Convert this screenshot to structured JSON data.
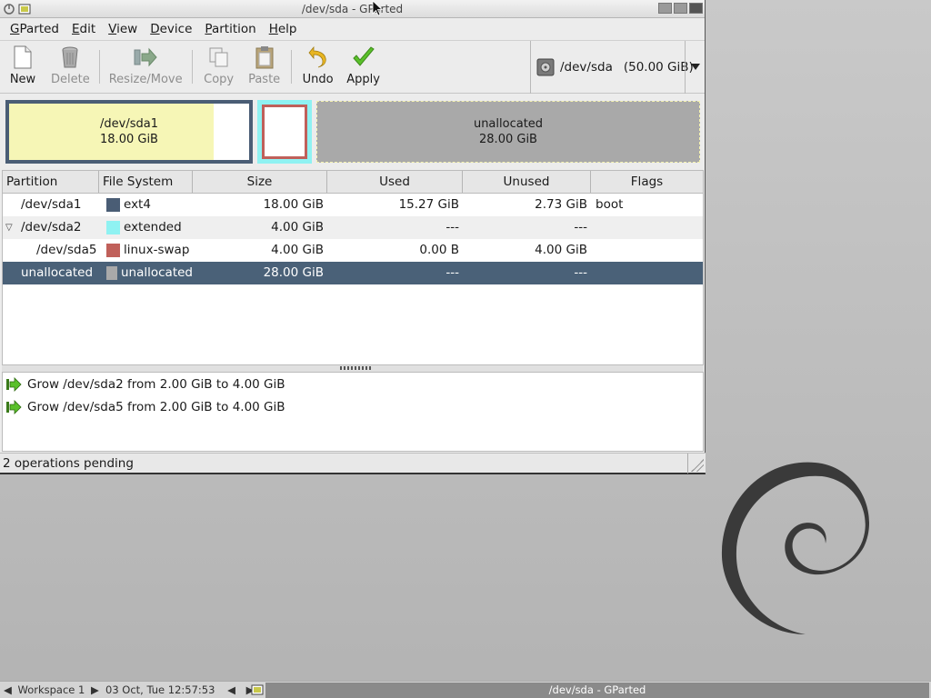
{
  "window": {
    "title": "/dev/sda - GParted"
  },
  "menu": [
    "GParted",
    "Edit",
    "View",
    "Device",
    "Partition",
    "Help"
  ],
  "toolbar": {
    "new": "New",
    "delete": "Delete",
    "resize": "Resize/Move",
    "copy": "Copy",
    "paste": "Paste",
    "undo": "Undo",
    "apply": "Apply"
  },
  "device": {
    "name": "/dev/sda",
    "size": "(50.00 GiB)"
  },
  "diskmap": {
    "sda1": {
      "name": "/dev/sda1",
      "size": "18.00 GiB"
    },
    "unallocated": {
      "name": "unallocated",
      "size": "28.00 GiB"
    }
  },
  "table": {
    "columns": [
      "Partition",
      "File System",
      "Size",
      "Used",
      "Unused",
      "Flags"
    ],
    "rows": [
      {
        "partition": "/dev/sda1",
        "fs": "ext4",
        "fs_color": "#4a5d75",
        "size": "18.00 GiB",
        "used": "15.27 GiB",
        "unused": "2.73 GiB",
        "flags": "boot"
      },
      {
        "partition": "/dev/sda2",
        "fs": "extended",
        "fs_color": "#8ff2f2",
        "size": "4.00 GiB",
        "used": "---",
        "unused": "---",
        "flags": ""
      },
      {
        "partition": "/dev/sda5",
        "fs": "linux-swap",
        "fs_color": "#c0605a",
        "size": "4.00 GiB",
        "used": "0.00 B",
        "unused": "4.00 GiB",
        "flags": ""
      },
      {
        "partition": "unallocated",
        "fs": "unallocated",
        "fs_color": "#a9a9a9",
        "size": "28.00 GiB",
        "used": "---",
        "unused": "---",
        "flags": ""
      }
    ]
  },
  "operations": [
    "Grow /dev/sda2 from 2.00 GiB to 4.00 GiB",
    "Grow /dev/sda5 from 2.00 GiB to 4.00 GiB"
  ],
  "status": "2 operations pending",
  "taskbar": {
    "workspace": "Workspace 1",
    "clock": "03 Oct, Tue 12:57:53",
    "task": "/dev/sda - GParted"
  },
  "colors": {
    "selection": "#4a6178",
    "ext4": "#4a5d75",
    "extended": "#8ff2f2",
    "swap": "#c0605a",
    "unallocated": "#a9a9a9"
  }
}
